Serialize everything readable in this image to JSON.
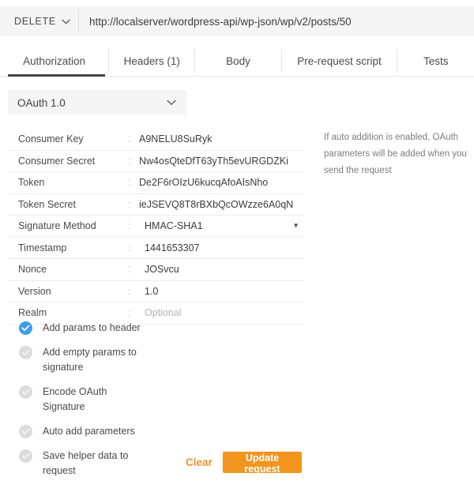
{
  "request_bar": {
    "method": "DELETE",
    "method_caret_icon": "chevron-down-icon",
    "url": "http://localserver/wordpress-api/wp-json/wp/v2/posts/50"
  },
  "tabs": [
    {
      "label": "Authorization",
      "active": true
    },
    {
      "label": "Headers (1)",
      "active": false
    },
    {
      "label": "Body",
      "active": false
    },
    {
      "label": "Pre-request script",
      "active": false
    },
    {
      "label": "Tests",
      "active": false
    }
  ],
  "auth_type": {
    "selected": "OAuth 1.0",
    "caret_icon": "chevron-down-icon"
  },
  "fields": [
    {
      "label": "Consumer Key",
      "separator": ":",
      "value": "A9NELU8SuRyk",
      "placeholder": false,
      "dropdown": false
    },
    {
      "label": "Consumer Secret",
      "separator": ":",
      "value": "Nw4osQteDfT63yTh5evURGDZKi",
      "placeholder": false,
      "dropdown": false
    },
    {
      "label": "Token",
      "separator": ":",
      "value": "De2F6rOIzU6kucqAfoAIsNho",
      "placeholder": false,
      "dropdown": false
    },
    {
      "label": "Token Secret",
      "separator": ":",
      "value": "ieJSEVQ8T8rBXbQcOWzze6A0qN",
      "placeholder": false,
      "dropdown": false
    },
    {
      "label": "Signature Method",
      "separator": ":",
      "value": "HMAC-SHA1",
      "placeholder": false,
      "dropdown": true
    },
    {
      "label": "Timestamp",
      "separator": ":",
      "value": "1441653307",
      "placeholder": false,
      "dropdown": false
    },
    {
      "label": "Nonce",
      "separator": ":",
      "value": "JOSvcu",
      "placeholder": false,
      "dropdown": false
    },
    {
      "label": "Version",
      "separator": ":",
      "value": "1.0",
      "placeholder": false,
      "dropdown": false
    },
    {
      "label": "Realm",
      "separator": ":",
      "value": "Optional",
      "placeholder": true,
      "dropdown": false
    }
  ],
  "help_text": "If auto addition is enabled, OAuth parameters will be added when you send the request",
  "options": [
    {
      "label": "Add params to header",
      "checked": true
    },
    {
      "label": "Add empty params to signature",
      "checked": false
    },
    {
      "label": "Encode OAuth Signature",
      "checked": false
    },
    {
      "label": "Auto add parameters",
      "checked": false
    },
    {
      "label": "Save helper data to request",
      "checked": false
    }
  ],
  "footer": {
    "clear_label": "Clear",
    "update_label": "Update request"
  },
  "colors": {
    "accent_orange": "#f2941e",
    "checked_blue": "#3ba0e8",
    "active_tab_underline": "#444444",
    "bar_background": "#f5f5f5"
  }
}
